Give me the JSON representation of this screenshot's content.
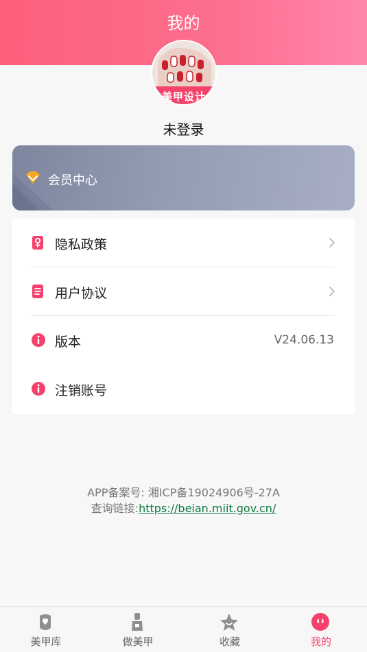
{
  "header": {
    "title": "我的"
  },
  "profile": {
    "avatar_banner_text": "美甲设计",
    "username": "未登录"
  },
  "vip": {
    "label": "会员中心",
    "icon": "diamond-icon",
    "icon_color": "#f5a623"
  },
  "menu": {
    "items": [
      {
        "label": "隐私政策",
        "icon": "privacy-icon",
        "value": ""
      },
      {
        "label": "用户协议",
        "icon": "document-icon",
        "value": ""
      },
      {
        "label": "版本",
        "icon": "info-icon",
        "value": "V24.06.13"
      },
      {
        "label": "注销账号",
        "icon": "info-icon",
        "value": ""
      }
    ],
    "icon_color": "#f6416c"
  },
  "footer": {
    "icp_text": "APP备案号: 湘ICP备19024906号-27A",
    "link_prefix": "查询链接:",
    "link_text": "https://beian.miit.gov.cn/"
  },
  "tabbar": {
    "tabs": [
      {
        "label": "美甲库",
        "icon": "nail-library-icon",
        "active": false
      },
      {
        "label": "做美甲",
        "icon": "nail-polish-icon",
        "active": false
      },
      {
        "label": "收藏",
        "icon": "star-icon",
        "active": false
      },
      {
        "label": "我的",
        "icon": "profile-face-icon",
        "active": true
      }
    ],
    "active_color": "#f6416c",
    "inactive_color": "#666666"
  },
  "colors": {
    "header_gradient_start": "#fc5f7c",
    "header_gradient_end": "#fe86ad"
  }
}
